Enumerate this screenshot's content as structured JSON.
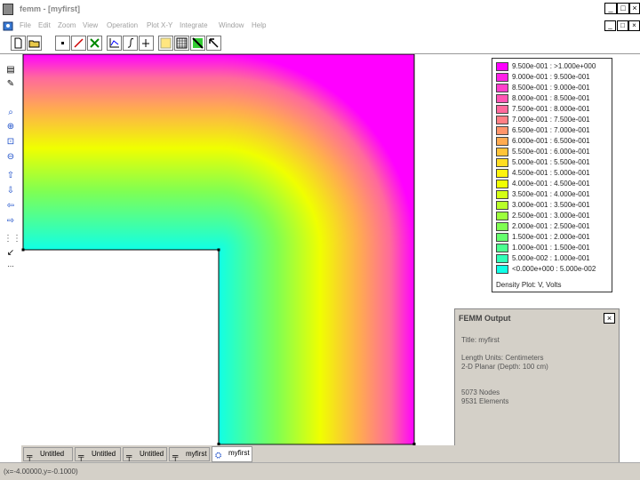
{
  "window": {
    "title": "femm - [myfirst]",
    "controls": [
      "_",
      "□",
      "×"
    ],
    "mdi_controls": [
      "_",
      "□",
      "×"
    ]
  },
  "menu": [
    "File",
    "Edit",
    "Zoom",
    "View",
    "Operation",
    "Plot X-Y",
    "Integrate",
    "Window",
    "Help"
  ],
  "toolbar": [
    "new-icon",
    "open-icon",
    "point-icon",
    "line-icon",
    "mesh-icon",
    "xy-plot-icon",
    "integral-icon",
    "contour-icon",
    "grid-icon",
    "density-plot-icon",
    "vector-plot-icon"
  ],
  "left_toolbar": [
    "select-icon",
    "edit-icon",
    "zoom-icon",
    "zoom-in-icon",
    "zoom-window-icon",
    "zoom-out-icon",
    "pan-up-icon",
    "pan-down-icon",
    "pan-left-icon",
    "pan-right-icon",
    "grid-toggle-icon",
    "snap-icon",
    "settings-icon"
  ],
  "legend": {
    "caption": "Density Plot: V, Volts",
    "entries": [
      {
        "label": "9.500e-001 : >1.000e+000",
        "color": "#ff00ff"
      },
      {
        "label": "9.000e-001 : 9.500e-001",
        "color": "#ff22e6"
      },
      {
        "label": "8.500e-001 : 9.000e-001",
        "color": "#ff3fcc"
      },
      {
        "label": "8.000e-001 : 8.500e-001",
        "color": "#ff55b4"
      },
      {
        "label": "7.500e-001 : 8.000e-001",
        "color": "#ff699c"
      },
      {
        "label": "7.000e-001 : 7.500e-001",
        "color": "#ff7f84"
      },
      {
        "label": "6.500e-001 : 7.000e-001",
        "color": "#ff956a"
      },
      {
        "label": "6.000e-001 : 6.500e-001",
        "color": "#ffab50"
      },
      {
        "label": "5.500e-001 : 6.000e-001",
        "color": "#ffc438"
      },
      {
        "label": "5.000e-001 : 5.500e-001",
        "color": "#ffdd22"
      },
      {
        "label": "4.500e-001 : 5.000e-001",
        "color": "#fff30c"
      },
      {
        "label": "4.000e-001 : 4.500e-001",
        "color": "#f0ff00"
      },
      {
        "label": "3.500e-001 : 4.000e-001",
        "color": "#d4ff14"
      },
      {
        "label": "3.000e-001 : 3.500e-001",
        "color": "#b8ff28"
      },
      {
        "label": "2.500e-001 : 3.000e-001",
        "color": "#9cff3c"
      },
      {
        "label": "2.000e-001 : 2.500e-001",
        "color": "#80ff52"
      },
      {
        "label": "1.500e-001 : 2.000e-001",
        "color": "#66ff6e"
      },
      {
        "label": "1.000e-001 : 1.500e-001",
        "color": "#4cff90"
      },
      {
        "label": "5.000e-002 : 1.000e-001",
        "color": "#30ffb8"
      },
      {
        "label": "<0.000e+000 : 5.000e-002",
        "color": "#10ffe6"
      }
    ]
  },
  "output": {
    "title": "FEMM Output",
    "close": "×",
    "lines": [
      "Title: myfirst",
      "Length Units: Centimeters",
      "2-D Planar (Depth: 100 cm)",
      "5073 Nodes",
      "9531 Elements"
    ]
  },
  "tabs": [
    {
      "label": "Untitled",
      "active": false
    },
    {
      "label": "Untitled",
      "active": false
    },
    {
      "label": "Untitled",
      "active": false
    },
    {
      "label": "myfirst",
      "active": false
    },
    {
      "label": "myfirst",
      "active": true
    }
  ],
  "status": "(x=-4.00000,y=-0.1000)"
}
